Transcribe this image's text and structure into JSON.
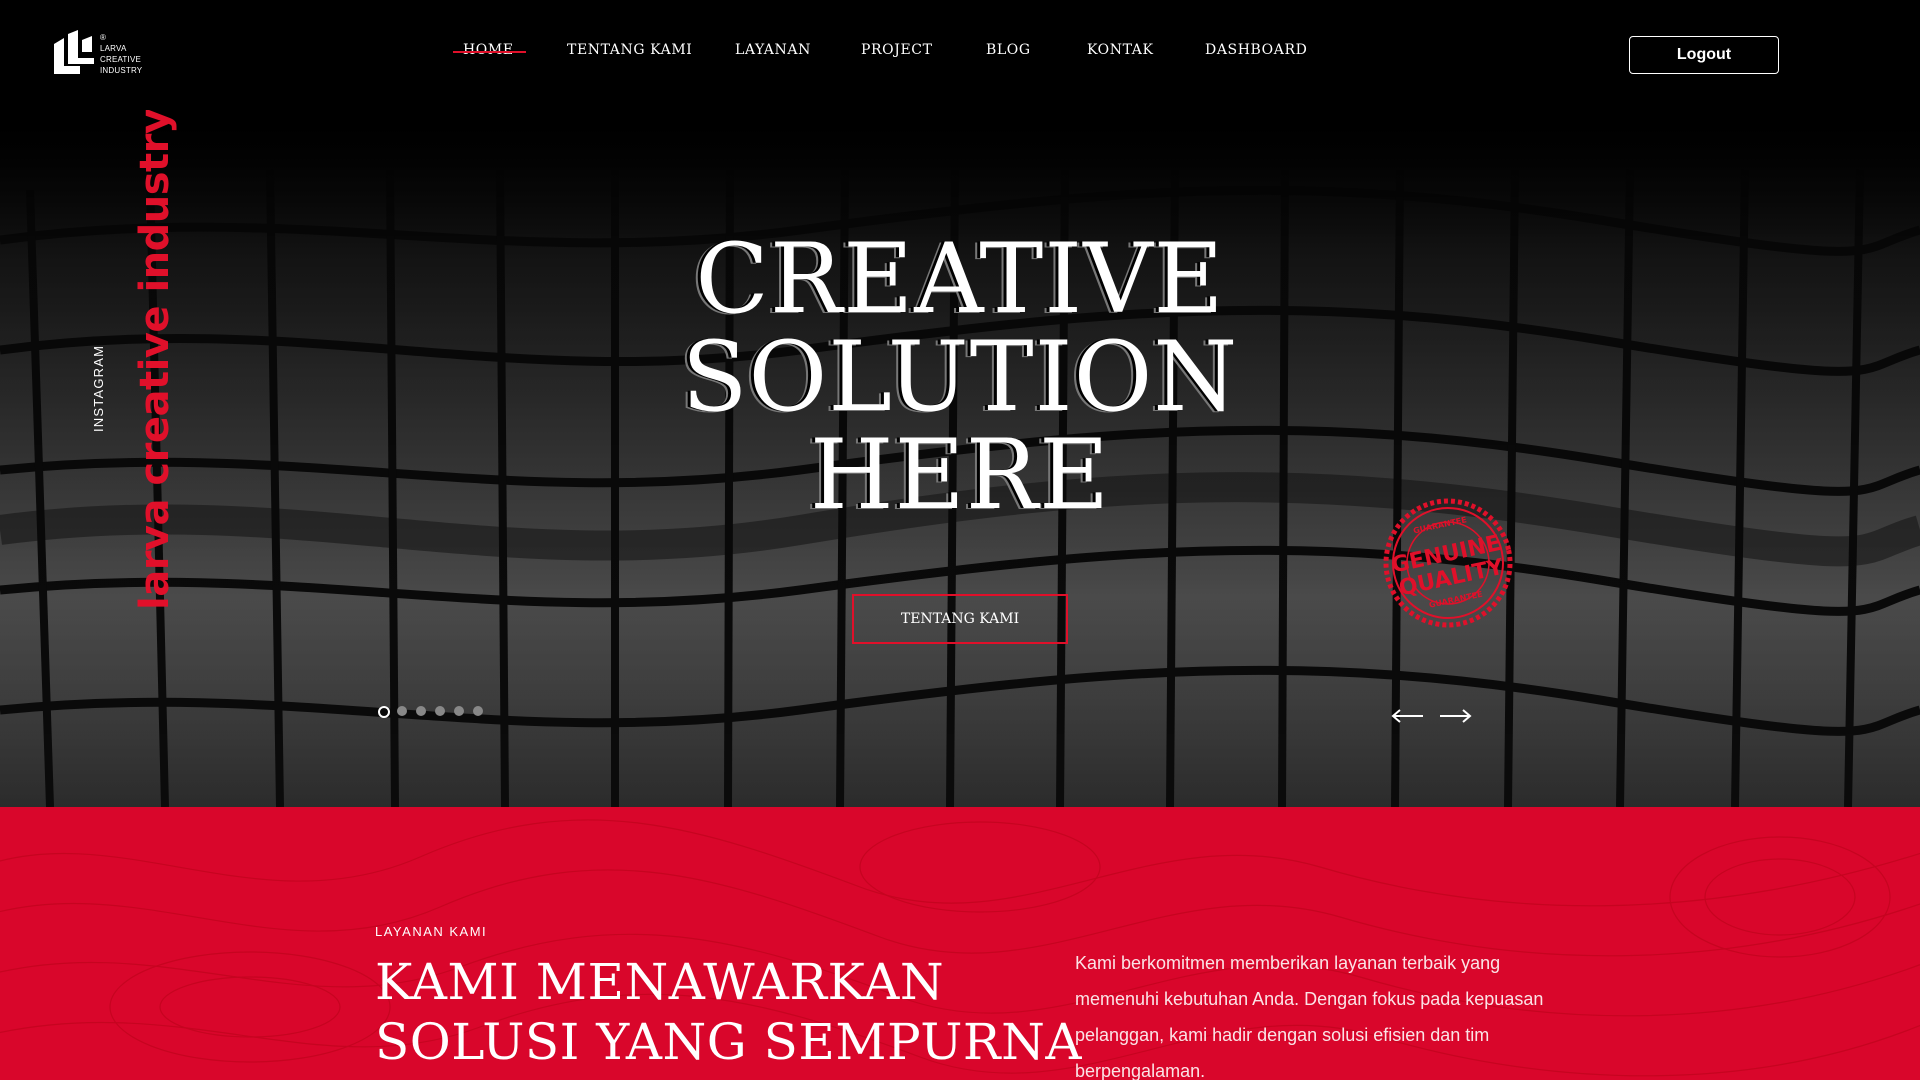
{
  "logo": {
    "brand_lines": [
      "LARVA",
      "CREATIVE",
      "INDUSTRY"
    ],
    "registered": "®"
  },
  "nav": {
    "items": [
      {
        "label": "HOME",
        "active": true
      },
      {
        "label": "TENTANG KAMI",
        "active": false
      },
      {
        "label": "LAYANAN",
        "active": false
      },
      {
        "label": "PROJECT",
        "active": false
      },
      {
        "label": "BLOG",
        "active": false
      },
      {
        "label": "KONTAK",
        "active": false
      },
      {
        "label": "DASHBOARD",
        "active": false
      }
    ],
    "logout_label": "Logout"
  },
  "hero": {
    "title_lines": [
      "CREATIVE",
      "SOLUTION",
      "HERE"
    ],
    "cta_label": "TENTANG KAMI",
    "side_brand": "larva creative industry®",
    "side_social": "INSTAGRAM",
    "slides": {
      "count": 6,
      "active_index": 0
    },
    "badge": {
      "top": "GUARANTEE",
      "line1": "GENUINE",
      "line2": "QUALITY",
      "bottom": "GUARANTEE"
    },
    "prev_icon": "arrow-left-icon",
    "next_icon": "arrow-right-icon"
  },
  "services": {
    "eyebrow": "LAYANAN KAMI",
    "heading_lines": [
      "KAMI MENAWARKAN",
      "SOLUSI YANG SEMPURNA"
    ],
    "description": "Kami berkomitmen memberikan layanan terbaik yang memenuhi kebutuhan Anda. Dengan fokus pada kepuasan pelanggan, kami hadir dengan solusi efisien dan tim berpengalaman."
  },
  "colors": {
    "accent": "#e0102a",
    "services_bg": "#d9062b",
    "header_bg": "#000000"
  }
}
